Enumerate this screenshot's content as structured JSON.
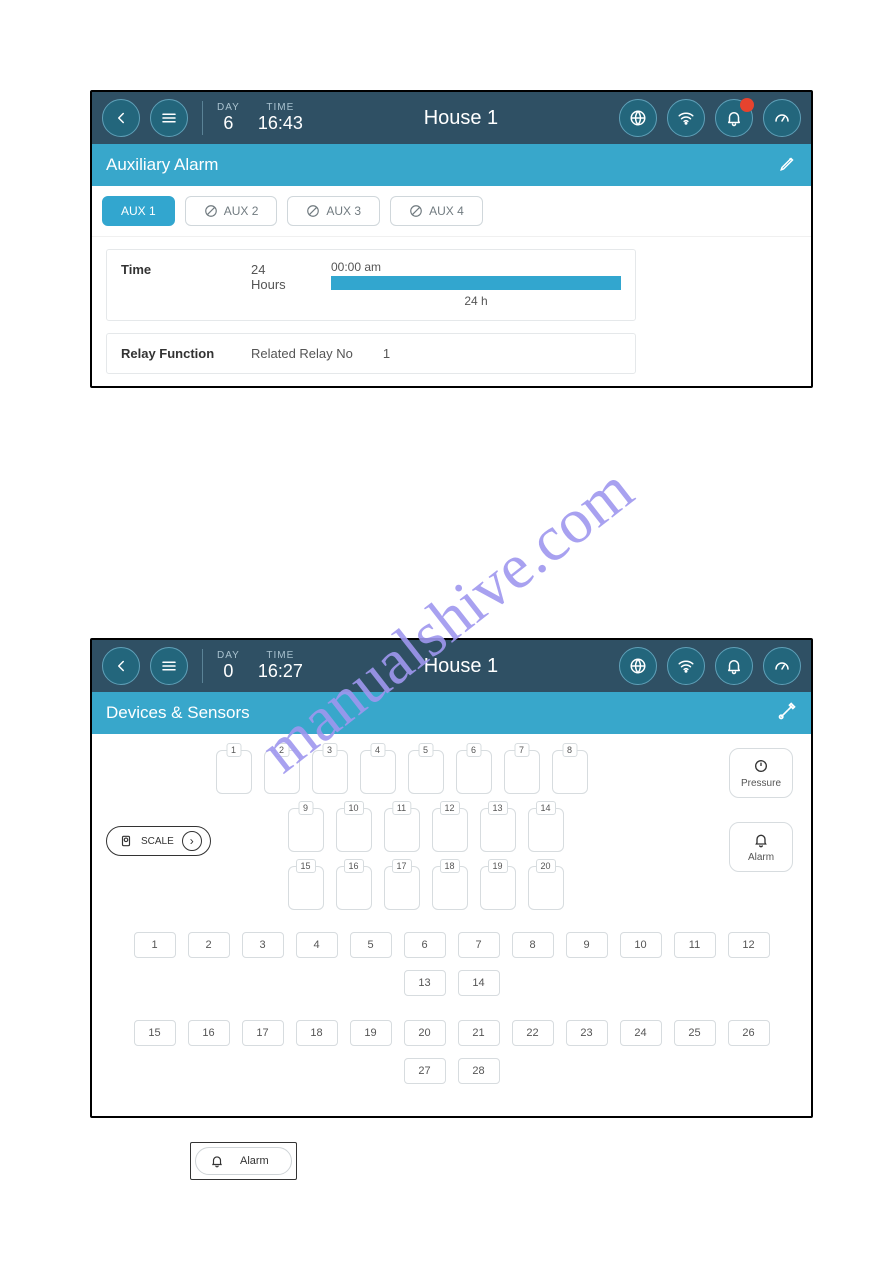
{
  "watermark": "manualshive.com",
  "panel1": {
    "header": {
      "day_label": "DAY",
      "day_value": "6",
      "time_label": "TIME",
      "time_value": "16:43",
      "title": "House 1",
      "bell_alert": true
    },
    "subtitle": "Auxiliary Alarm",
    "tabs": [
      "AUX 1",
      "AUX 2",
      "AUX 3",
      "AUX 4"
    ],
    "time_card": {
      "label": "Time",
      "mode": "24 Hours",
      "start": "00:00 am",
      "span": "24 h"
    },
    "relay_card": {
      "label": "Relay Function",
      "field": "Related Relay No",
      "value": "1"
    }
  },
  "panel2": {
    "header": {
      "day_label": "DAY",
      "day_value": "0",
      "time_label": "TIME",
      "time_value": "16:27",
      "title": "House 1",
      "bell_alert": false
    },
    "subtitle": "Devices & Sensors",
    "scale_label": "SCALE",
    "device_rows": [
      [
        "1",
        "2",
        "3",
        "4",
        "5",
        "6",
        "7",
        "8"
      ],
      [
        "9",
        "10",
        "11",
        "12",
        "13",
        "14"
      ],
      [
        "15",
        "16",
        "17",
        "18",
        "19",
        "20"
      ]
    ],
    "side": {
      "pressure": "Pressure",
      "alarm": "Alarm"
    },
    "relays_row1": [
      "1",
      "2",
      "3",
      "4",
      "5",
      "6",
      "7",
      "8",
      "9",
      "10",
      "11",
      "12",
      "13",
      "14"
    ],
    "relays_row2": [
      "15",
      "16",
      "17",
      "18",
      "19",
      "20",
      "21",
      "22",
      "23",
      "24",
      "25",
      "26",
      "27",
      "28"
    ]
  },
  "alarm_chip": "Alarm"
}
